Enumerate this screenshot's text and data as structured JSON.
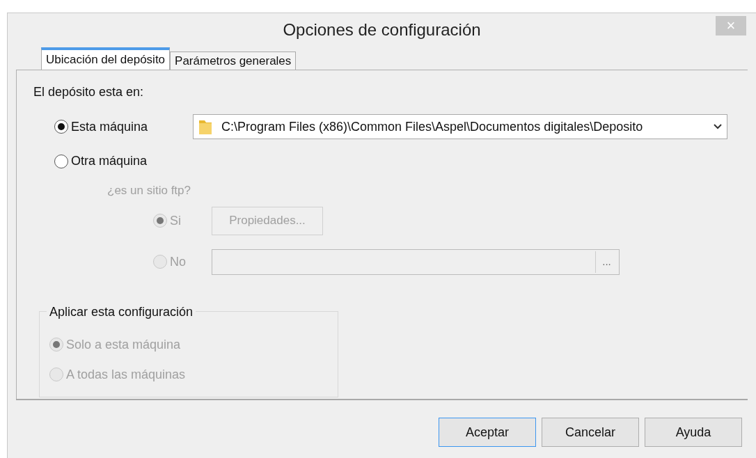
{
  "window": {
    "title": "Opciones de configuración",
    "close": "×"
  },
  "tabs": [
    {
      "label": "Ubicación del depósito",
      "selected": true
    },
    {
      "label": "Parámetros generales",
      "selected": false
    }
  ],
  "location_label": "El depósito esta en:",
  "location_options": [
    {
      "label": "Esta máquina",
      "selected": true,
      "disabled": false
    },
    {
      "label": "Otra máquina",
      "selected": false,
      "disabled": false
    }
  ],
  "path_combo": {
    "value": "C:\\Program Files (x86)\\Common Files\\Aspel\\Documentos digitales\\Deposito"
  },
  "ftp_question": "¿es un sitio ftp?",
  "ftp_options": [
    {
      "label": "Si",
      "selected": true,
      "disabled": true
    },
    {
      "label": "No",
      "selected": false,
      "disabled": true
    }
  ],
  "properties_button": {
    "label": "Propiedades...",
    "disabled": true
  },
  "ftp_path_field": {
    "browse": "...",
    "disabled": true
  },
  "apply_group": {
    "title": "Aplicar esta configuración",
    "options": [
      {
        "label": "Solo a esta máquina",
        "selected": true,
        "disabled": true
      },
      {
        "label": "A todas las máquinas",
        "selected": false,
        "disabled": true
      }
    ]
  },
  "buttons": [
    {
      "label": "Aceptar",
      "default": true
    },
    {
      "label": "Cancelar",
      "default": false
    },
    {
      "label": "Ayuda",
      "default": false
    }
  ]
}
